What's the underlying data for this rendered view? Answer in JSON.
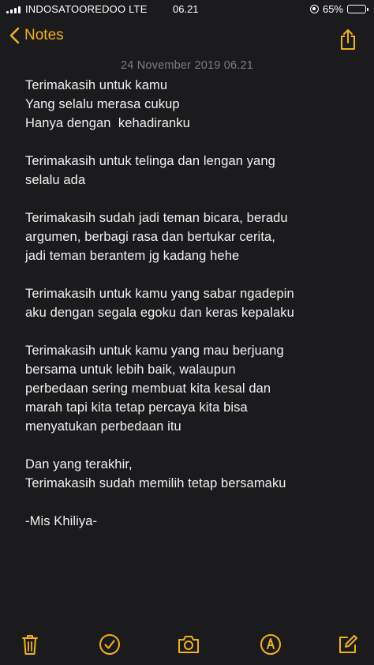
{
  "status_bar": {
    "carrier": "INDOSATOOREDOO LTE",
    "time": "06.21",
    "battery": "65%",
    "battery_level": 0.65
  },
  "nav": {
    "back_label": "Notes"
  },
  "note": {
    "date": "24 November 2019 06.21",
    "lines": [
      "Terimakasih untuk kamu",
      "Yang selalu merasa cukup",
      "Hanya dengan  kehadiranku",
      "",
      "Terimakasih untuk telinga dan lengan yang",
      "selalu ada",
      "",
      "Terimakasih sudah jadi teman bicara, beradu",
      "argumen, berbagi rasa dan bertukar cerita,",
      "jadi teman berantem jg kadang hehe",
      "",
      "Terimakasih untuk kamu yang sabar ngadepin",
      "aku dengan segala egoku dan keras kepalaku",
      "",
      "Terimakasih untuk kamu yang mau berjuang",
      "bersama untuk lebih baik, walaupun",
      "perbedaan sering membuat kita kesal dan",
      "marah tapi kita tetap percaya kita bisa",
      "menyatukan perbedaan itu",
      "",
      "Dan yang terakhir,",
      "Terimakasih sudah memilih tetap bersamaku",
      "",
      "-Mis Khiliya-"
    ]
  },
  "toolbar": {
    "icons": [
      "trash-icon",
      "checklist-icon",
      "camera-icon",
      "markup-icon",
      "compose-icon"
    ]
  },
  "colors": {
    "accent": "#f1b214",
    "background": "#1b1b1d",
    "date_text": "#7d7d82",
    "body_text": "#f2f2f2"
  }
}
